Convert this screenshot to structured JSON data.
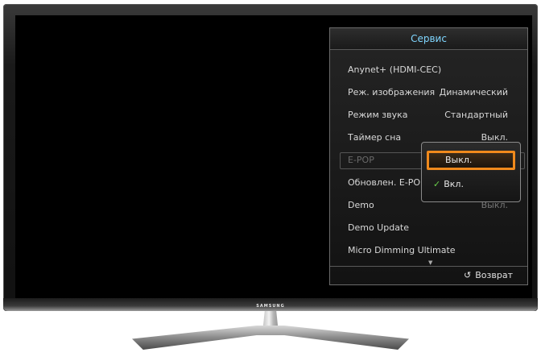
{
  "brand": "SAMSUNG",
  "menu": {
    "title": "Сервис",
    "items": [
      {
        "label": "Anynet+ (HDMI-CEC)",
        "value": ""
      },
      {
        "label": "Реж. изображения",
        "value": "Динамический"
      },
      {
        "label": "Режим звука",
        "value": "Стандартный"
      },
      {
        "label": "Таймер сна",
        "value": "Выкл."
      },
      {
        "label": "E-POP",
        "value": ""
      },
      {
        "label": "Обновлен. E-POP",
        "value": ""
      },
      {
        "label": "Demo",
        "value": "Выкл."
      },
      {
        "label": "Demo Update",
        "value": ""
      },
      {
        "label": "Micro Dimming Ultimate",
        "value": ""
      }
    ],
    "scroll_down": "▼",
    "return_icon": "↺",
    "return_label": "Возврат"
  },
  "popup": {
    "options": [
      {
        "label": "Выкл.",
        "selected": true
      },
      {
        "label": "Вкл.",
        "checked": true
      }
    ],
    "check_icon": "✓"
  }
}
